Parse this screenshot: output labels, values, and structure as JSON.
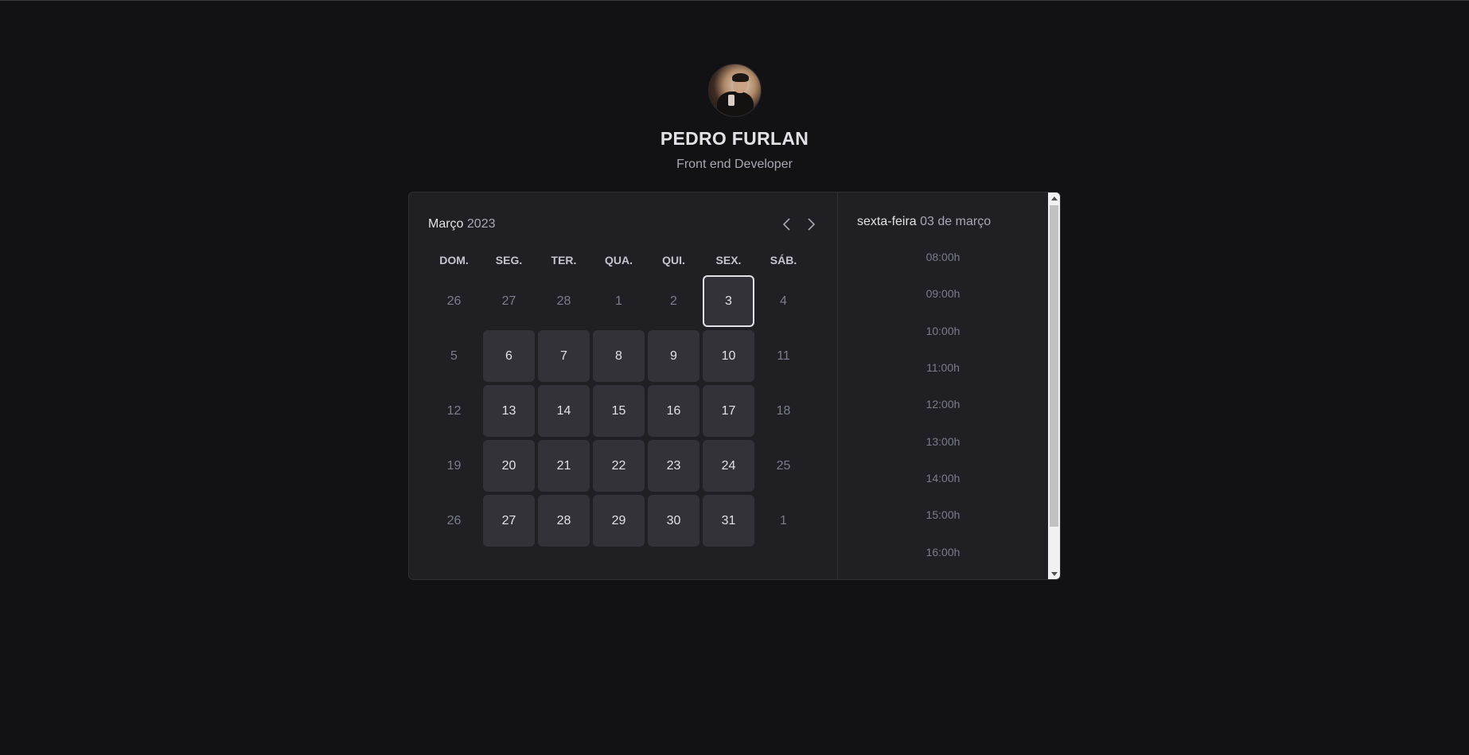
{
  "profile": {
    "name": "PEDRO FURLAN",
    "role": "Front end Developer"
  },
  "calendar": {
    "month": "Março",
    "year": "2023",
    "weekdays": [
      "DOM.",
      "SEG.",
      "TER.",
      "QUA.",
      "QUI.",
      "SEX.",
      "SÁB."
    ],
    "weeks": [
      [
        {
          "day": "26",
          "state": "disabled"
        },
        {
          "day": "27",
          "state": "disabled"
        },
        {
          "day": "28",
          "state": "disabled"
        },
        {
          "day": "1",
          "state": "disabled"
        },
        {
          "day": "2",
          "state": "disabled"
        },
        {
          "day": "3",
          "state": "selected"
        },
        {
          "day": "4",
          "state": "disabled"
        }
      ],
      [
        {
          "day": "5",
          "state": "disabled"
        },
        {
          "day": "6",
          "state": "available"
        },
        {
          "day": "7",
          "state": "available"
        },
        {
          "day": "8",
          "state": "available"
        },
        {
          "day": "9",
          "state": "available"
        },
        {
          "day": "10",
          "state": "available"
        },
        {
          "day": "11",
          "state": "disabled"
        }
      ],
      [
        {
          "day": "12",
          "state": "disabled"
        },
        {
          "day": "13",
          "state": "available"
        },
        {
          "day": "14",
          "state": "available"
        },
        {
          "day": "15",
          "state": "available"
        },
        {
          "day": "16",
          "state": "available"
        },
        {
          "day": "17",
          "state": "available"
        },
        {
          "day": "18",
          "state": "disabled"
        }
      ],
      [
        {
          "day": "19",
          "state": "disabled"
        },
        {
          "day": "20",
          "state": "available"
        },
        {
          "day": "21",
          "state": "available"
        },
        {
          "day": "22",
          "state": "available"
        },
        {
          "day": "23",
          "state": "available"
        },
        {
          "day": "24",
          "state": "available"
        },
        {
          "day": "25",
          "state": "disabled"
        }
      ],
      [
        {
          "day": "26",
          "state": "disabled"
        },
        {
          "day": "27",
          "state": "available"
        },
        {
          "day": "28",
          "state": "available"
        },
        {
          "day": "29",
          "state": "available"
        },
        {
          "day": "30",
          "state": "available"
        },
        {
          "day": "31",
          "state": "available"
        },
        {
          "day": "1",
          "state": "disabled"
        }
      ]
    ]
  },
  "time_picker": {
    "weekday": "sexta-feira",
    "date": "03 de março",
    "times": [
      "08:00h",
      "09:00h",
      "10:00h",
      "11:00h",
      "12:00h",
      "13:00h",
      "14:00h",
      "15:00h",
      "16:00h"
    ]
  },
  "icons": {
    "prev": "chevron-left-icon",
    "next": "chevron-right-icon"
  },
  "colors": {
    "background": "#121214",
    "card": "#202024",
    "day_available": "#323238",
    "text": "#e1e1e6",
    "muted": "#7c7c8a"
  }
}
